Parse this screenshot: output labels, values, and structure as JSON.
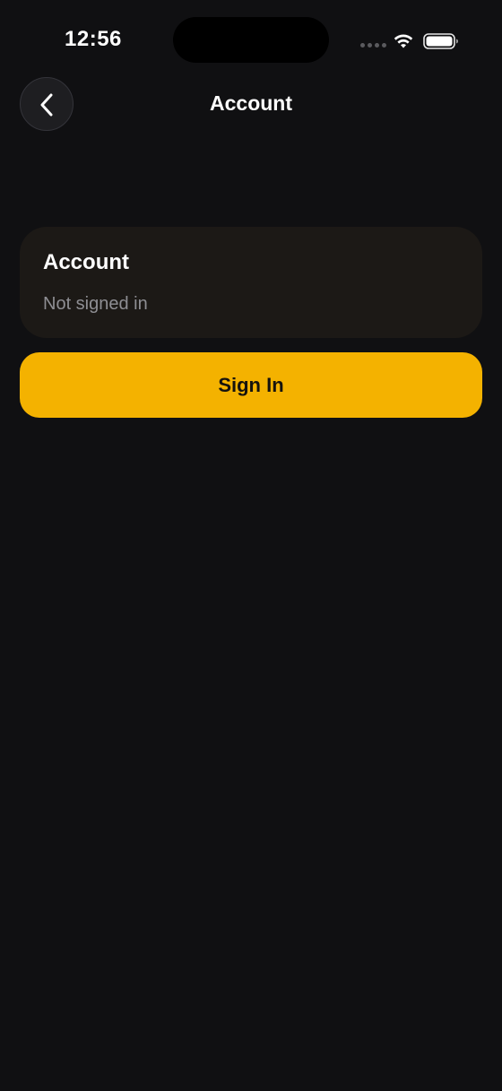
{
  "status_bar": {
    "time": "12:56",
    "icons": [
      "signal-dots-icon",
      "wifi-icon",
      "battery-icon"
    ]
  },
  "nav": {
    "title": "Account",
    "back_icon": "chevron-left-icon"
  },
  "account_card": {
    "heading": "Account",
    "status": "Not signed in"
  },
  "sign_in_button": {
    "label": "Sign In"
  },
  "colors": {
    "background": "#101012",
    "card": "#1c1916",
    "accent": "#f4b200",
    "secondary_text": "#8e8e93"
  }
}
